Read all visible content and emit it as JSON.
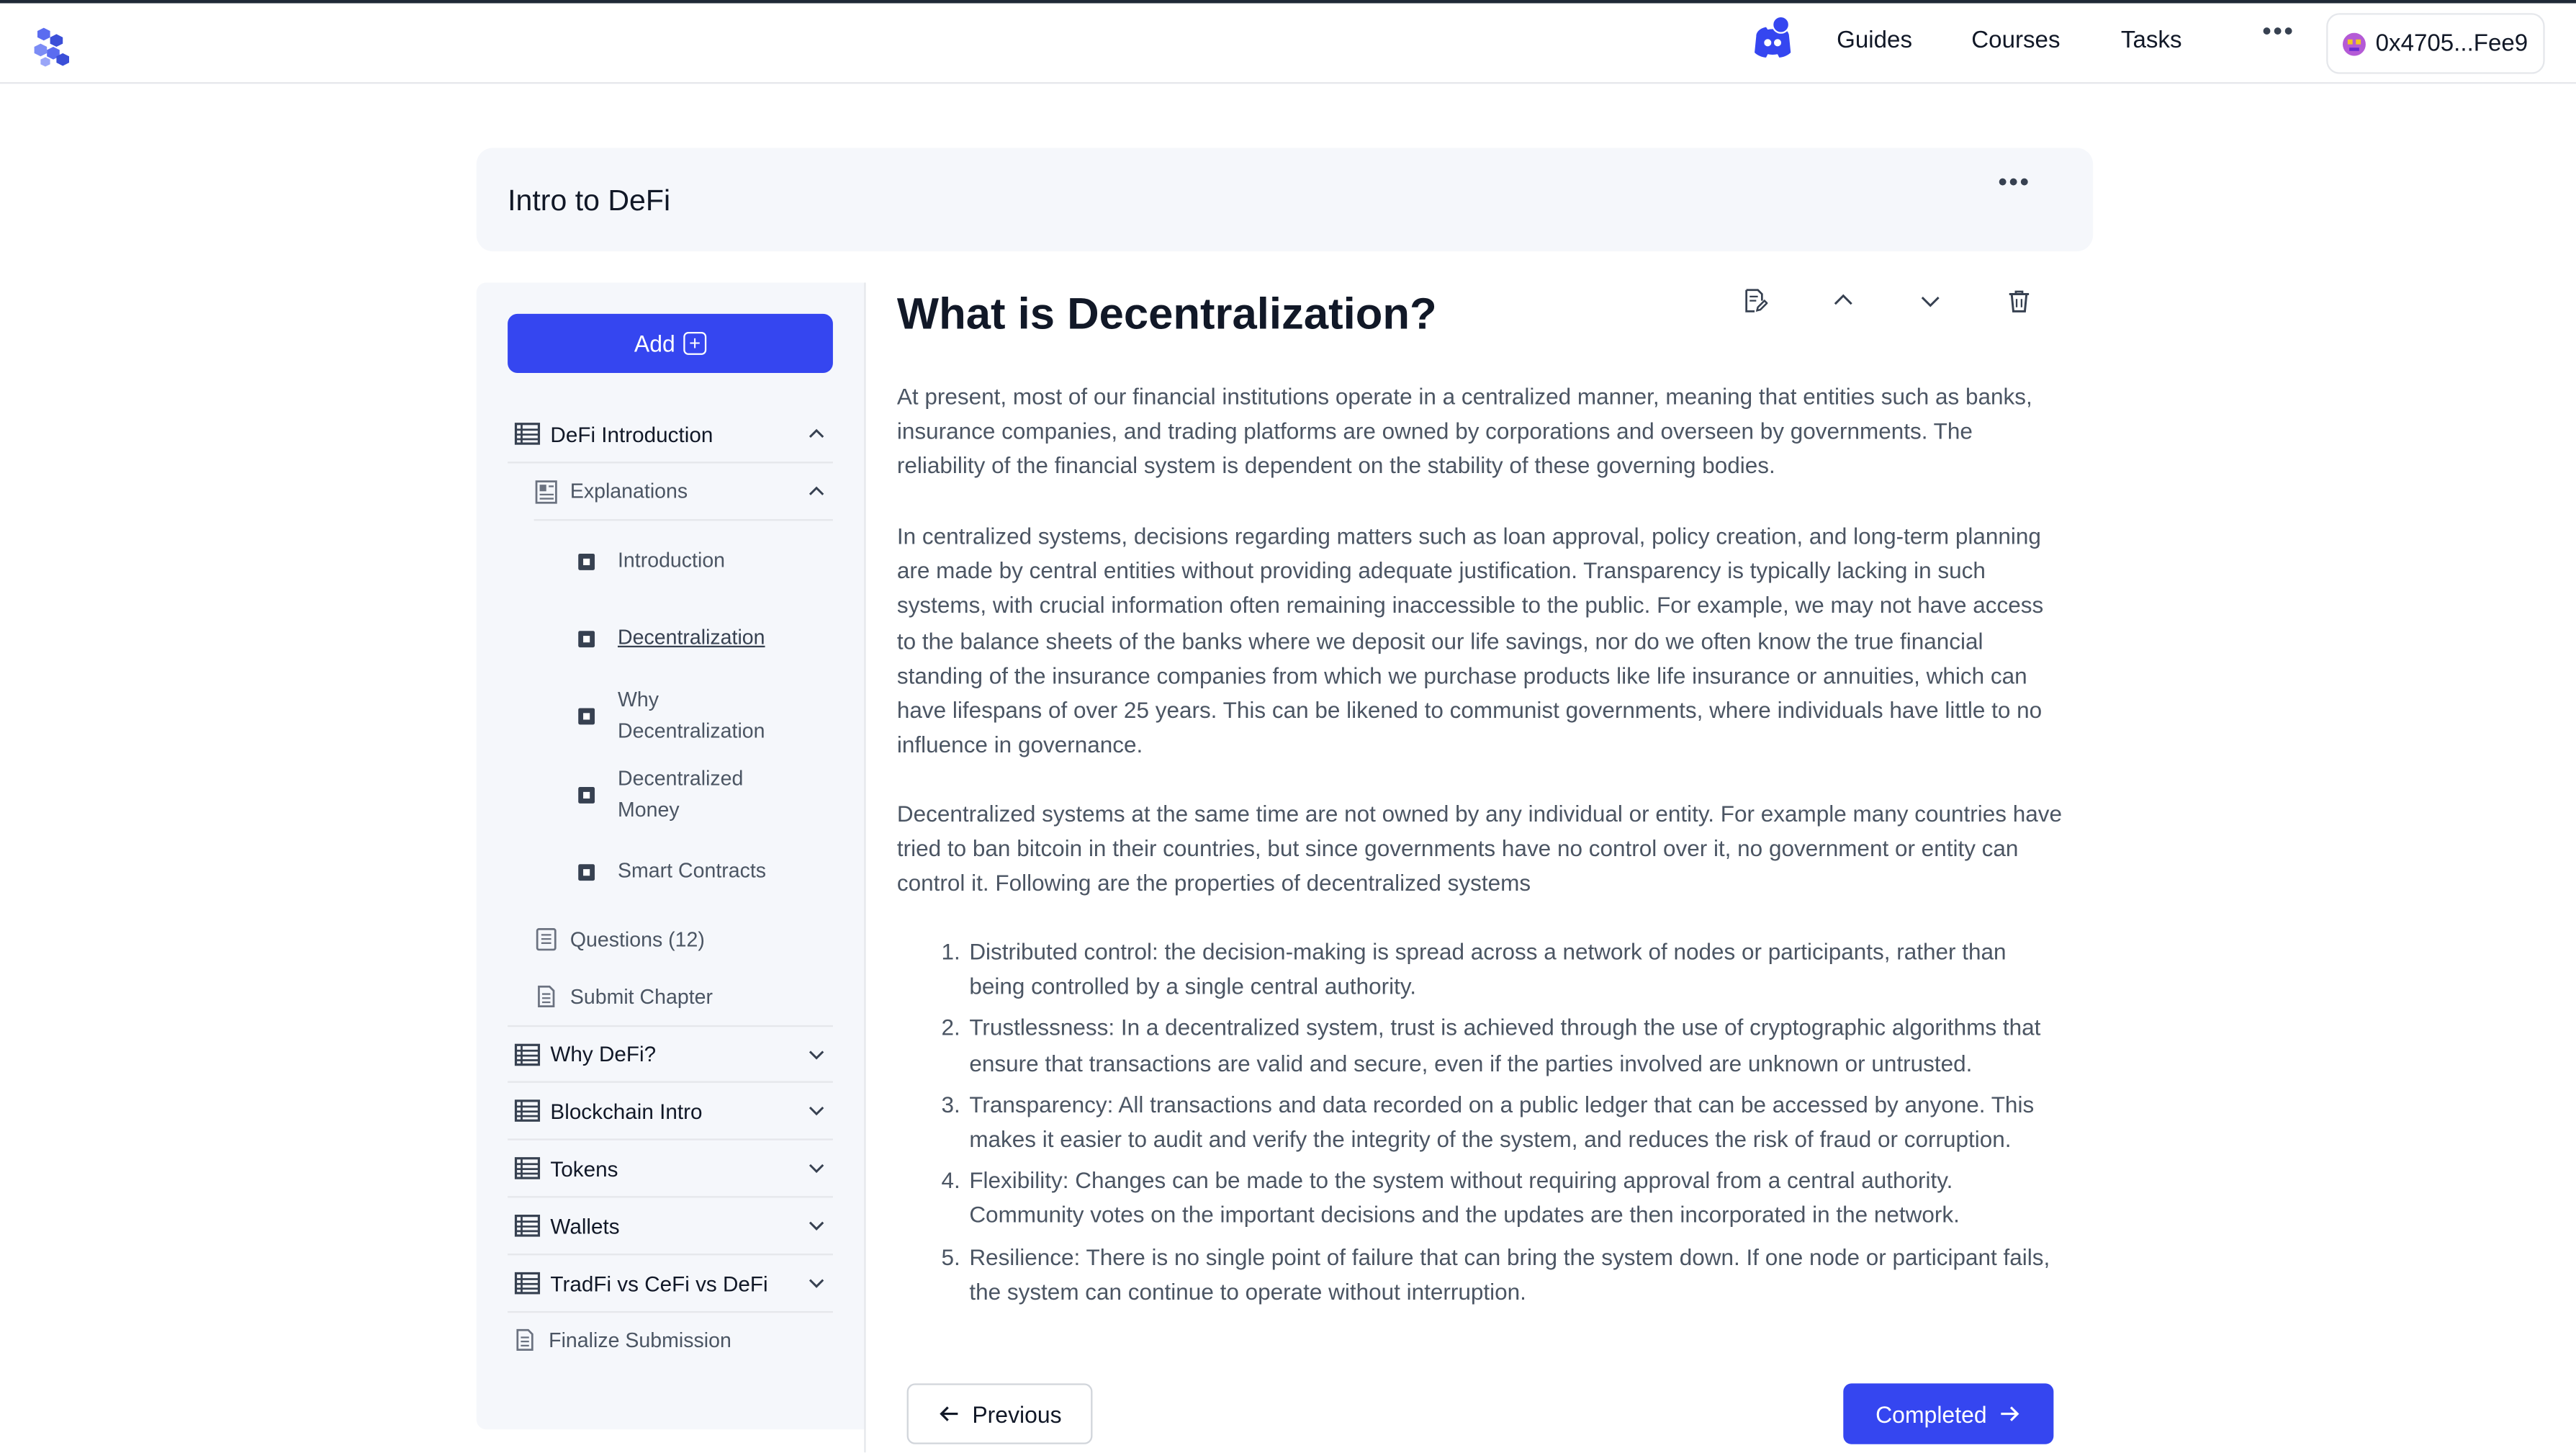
{
  "navbar": {
    "logo_icon": "hexagon-swarm-logo",
    "discord_icon": "discord-icon",
    "links": [
      "Guides",
      "Courses",
      "Tasks"
    ],
    "more": "•••",
    "wallet": "0x4705...Fee9"
  },
  "course": {
    "title": "Intro to DeFi",
    "more": "•••"
  },
  "sidebar": {
    "add_label": "Add",
    "chapters": [
      {
        "label": "DeFi Introduction",
        "expanded": true
      },
      {
        "label": "Why DeFi?",
        "expanded": false
      },
      {
        "label": "Blockchain Intro",
        "expanded": false
      },
      {
        "label": "Tokens",
        "expanded": false
      },
      {
        "label": "Wallets",
        "expanded": false
      },
      {
        "label": "TradFi vs CeFi vs DeFi",
        "expanded": false
      }
    ],
    "explanations_label": "Explanations",
    "pages": [
      "Introduction",
      "Decentralization",
      "Why Decentralization",
      "Decentralized Money",
      "Smart Contracts"
    ],
    "active_page": "Decentralization",
    "questions_label": "Questions (12)",
    "submit_label": "Submit Chapter",
    "finalize_label": "Finalize Submission"
  },
  "content": {
    "title": "What is Decentralization?",
    "paragraphs": [
      "At present, most of our financial institutions operate in a centralized manner, meaning that entities such as banks, insurance companies, and trading platforms are owned by corporations and overseen by governments. The reliability of the financial system is dependent on the stability of these governing bodies.",
      "In centralized systems, decisions regarding matters such as loan approval, policy creation, and long-term planning are made by central entities without providing adequate justification. Transparency is typically lacking in such systems, with crucial information often remaining inaccessible to the public. For example, we may not have access to the balance sheets of the banks where we deposit our life savings, nor do we often know the true financial standing of the insurance companies from which we purchase products like life insurance or annuities, which can have lifespans of over 25 years. This can be likened to communist governments, where individuals have little to no influence in governance.",
      "Decentralized systems at the same time are not owned by any individual or entity. For example many countries have tried to ban bitcoin in their countries, but since governments have no control over it, no government or entity can control it. Following are the properties of decentralized systems"
    ],
    "list": [
      "Distributed control: the decision-making is spread across a network of nodes or participants, rather than being controlled by a single central authority.",
      "Trustlessness: In a decentralized system, trust is achieved through the use of cryptographic algorithms that ensure that transactions are valid and secure, even if the parties involved are unknown or untrusted.",
      "Transparency: All transactions and data recorded on a public ledger that can be accessed by anyone. This makes it easier to audit and verify the integrity of the system, and reduces the risk of fraud or corruption.",
      "Flexibility: Changes can be made to the system without requiring approval from a central authority. Community votes on the important decisions and the updates are then incorporated in the network.",
      "Resilience: There is no single point of failure that can bring the system down. If one node or participant fails, the system can continue to operate without interruption."
    ],
    "list_numbers": [
      "1.",
      "2.",
      "3.",
      "4.",
      "5."
    ],
    "prev_label": "Previous",
    "next_label": "Completed"
  },
  "colors": {
    "primary": "#3546f0",
    "panel_bg": "#f5f7fb",
    "text_muted": "#4b5563"
  }
}
